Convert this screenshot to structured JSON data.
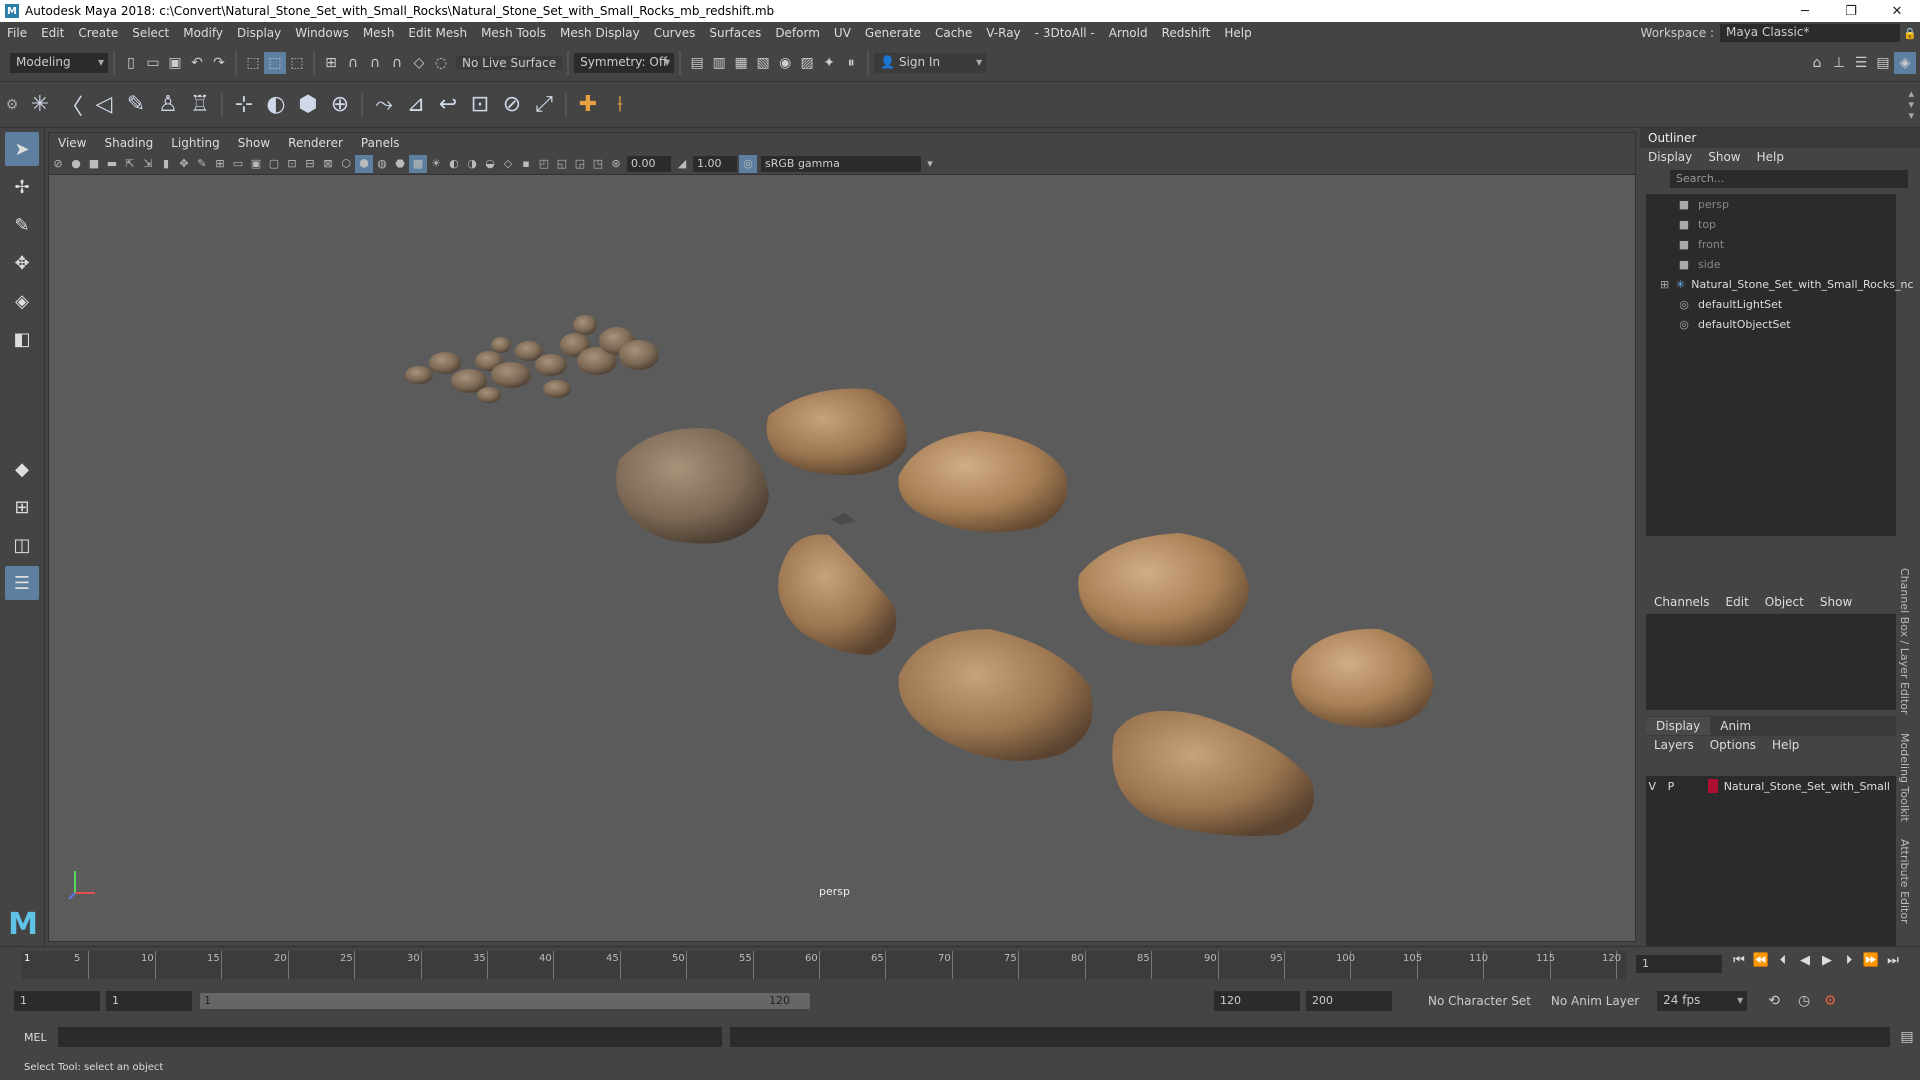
{
  "window": {
    "title": "Autodesk Maya 2018: c:\\Convert\\Natural_Stone_Set_with_Small_Rocks\\Natural_Stone_Set_with_Small_Rocks_mb_redshift.mb",
    "logo": "M",
    "minimize": "─",
    "maximize": "❐",
    "close": "✕"
  },
  "menubar": {
    "items": [
      "File",
      "Edit",
      "Create",
      "Select",
      "Modify",
      "Display",
      "Windows",
      "Mesh",
      "Edit Mesh",
      "Mesh Tools",
      "Mesh Display",
      "Curves",
      "Surfaces",
      "Deform",
      "UV",
      "Generate",
      "Cache",
      "V-Ray",
      "- 3DtoAll -",
      "Arnold",
      "Redshift",
      "Help"
    ],
    "workspace_label": "Workspace :",
    "workspace_value": "Maya Classic*"
  },
  "statusline": {
    "mode": "Modeling",
    "live_surface": "No Live Surface",
    "symmetry": "Symmetry: Off",
    "sign_in": "Sign In"
  },
  "viewport": {
    "menus": [
      "View",
      "Shading",
      "Lighting",
      "Show",
      "Renderer",
      "Panels"
    ],
    "exposure": "0.00",
    "gamma_value": "1.00",
    "color_space": "sRGB gamma",
    "camera": "persp"
  },
  "outliner": {
    "title": "Outliner",
    "menus": [
      "Display",
      "Show",
      "Help"
    ],
    "search_placeholder": "Search...",
    "items": [
      {
        "label": "persp",
        "icon": "camera-icon"
      },
      {
        "label": "top",
        "icon": "camera-icon"
      },
      {
        "label": "front",
        "icon": "camera-icon"
      },
      {
        "label": "side",
        "icon": "camera-icon"
      },
      {
        "label": "Natural_Stone_Set_with_Small_Rocks_nc",
        "icon": "group-icon"
      },
      {
        "label": "defaultLightSet",
        "icon": "set-icon"
      },
      {
        "label": "defaultObjectSet",
        "icon": "set-icon"
      }
    ]
  },
  "channelbox": {
    "menus": [
      "Channels",
      "Edit",
      "Object",
      "Show"
    ]
  },
  "layers": {
    "tabs": [
      "Display",
      "Anim"
    ],
    "menus": [
      "Layers",
      "Options",
      "Help"
    ],
    "row": {
      "v": "V",
      "p": "P",
      "name": "Natural_Stone_Set_with_Small",
      "color": "#b01030"
    }
  },
  "side_tabs": [
    "Channel Box / Layer Editor",
    "Modeling Toolkit",
    "Attribute Editor"
  ],
  "timeline": {
    "ticks": [
      "5",
      "10",
      "15",
      "20",
      "25",
      "30",
      "35",
      "40",
      "45",
      "50",
      "55",
      "60",
      "65",
      "70",
      "75",
      "80",
      "85",
      "90",
      "95",
      "100",
      "105",
      "110",
      "115",
      "120"
    ],
    "start_marker": "1",
    "current_frame": "1"
  },
  "range": {
    "start": "1",
    "playback_start": "1",
    "slider_start": "1",
    "slider_end": "120",
    "playback_end": "120",
    "end": "200",
    "character_set": "No Character Set",
    "anim_layer": "No Anim Layer",
    "fps": "24 fps"
  },
  "command": {
    "language": "MEL"
  },
  "help": {
    "text": "Select Tool: select an object"
  }
}
